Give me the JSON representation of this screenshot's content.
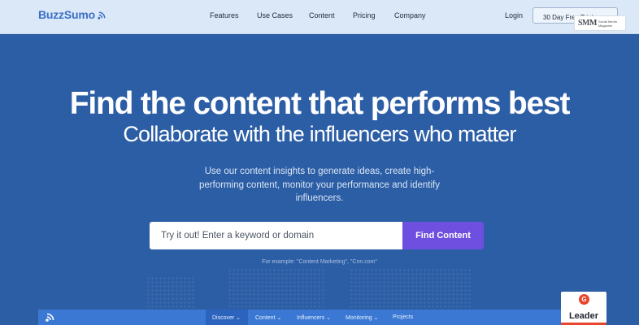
{
  "header": {
    "logo_text": "BuzzSumo",
    "nav": [
      "Features",
      "Use Cases",
      "Content",
      "Pricing",
      "Company"
    ],
    "login_label": "Login",
    "trial_label": "30 Day Free Trial",
    "watermark": {
      "big": "SMM",
      "small_line1": "Social Media",
      "small_line2": "Magazine"
    }
  },
  "hero": {
    "title": "Find the content that performs best",
    "subtitle": "Collaborate with the influencers who matter",
    "description": "Use our content insights to generate ideas, create high-performing content, monitor your performance and identify influencers."
  },
  "search": {
    "placeholder": "Try it out! Enter a keyword or domain",
    "button_label": "Find Content",
    "example_text": "For example: \"Content Marketing\", \"Cnn.com\""
  },
  "app_preview": {
    "tabs": [
      "Discover ⌄",
      "Content ⌄",
      "Influencers ⌄",
      "Monitoring ⌄",
      "Projects"
    ]
  },
  "badge": {
    "g_letter": "G",
    "label": "Leader"
  },
  "colors": {
    "hero_bg": "#2c5ea6",
    "header_bg": "#dbe8f7",
    "accent_button": "#6f4fe0",
    "brand_blue": "#3b6fc4"
  }
}
